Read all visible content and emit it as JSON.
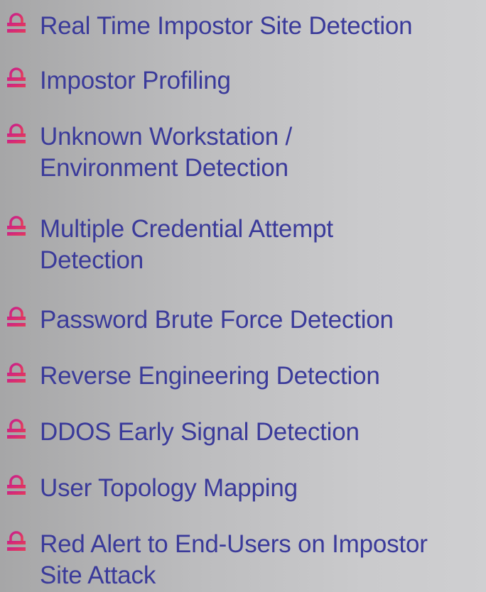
{
  "accent_colors": {
    "text": "#3a3a9a",
    "icon_gradient_start": "#c81d8d",
    "icon_gradient_end": "#e83f55"
  },
  "icon": "lock-icon",
  "features": [
    {
      "label": "Real Time Impostor Site Detection"
    },
    {
      "label": "Impostor Profiling"
    },
    {
      "label": "Unknown Workstation /\nEnvironment Detection"
    },
    {
      "label": "Multiple Credential Attempt\nDetection"
    },
    {
      "label": "Password Brute Force Detection"
    },
    {
      "label": "Reverse Engineering Detection"
    },
    {
      "label": "DDOS Early Signal Detection"
    },
    {
      "label": "User Topology Mapping"
    },
    {
      "label": "Red Alert to End-Users on Impostor\nSite Attack"
    }
  ]
}
